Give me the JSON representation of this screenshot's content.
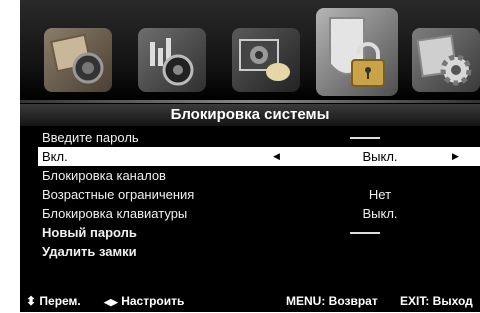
{
  "menu_title": "Блокировка системы",
  "tabs": [
    {
      "icon": "picture-icon",
      "active": false
    },
    {
      "icon": "sound-icon",
      "active": false
    },
    {
      "icon": "channel-icon",
      "active": false
    },
    {
      "icon": "lock-icon",
      "active": true
    },
    {
      "icon": "settings-gear-icon",
      "active": false
    }
  ],
  "items": [
    {
      "label": "Введите пароль",
      "value": "",
      "style": "normal"
    },
    {
      "label": "Вкл.",
      "value": "Выкл.",
      "style": "selected"
    },
    {
      "label": "Блокировка каналов",
      "value": "",
      "style": "normal"
    },
    {
      "label": "Возрастные ограничения",
      "value": "Нет",
      "style": "normal"
    },
    {
      "label": "Блокировка клавиатуры",
      "value": "Выкл.",
      "style": "normal"
    },
    {
      "label": "Новый пароль",
      "value": "",
      "style": "bold"
    },
    {
      "label": "Удалить замки",
      "value": "",
      "style": "bold"
    }
  ],
  "footer": {
    "move_label": "Перем.",
    "adjust_label": "Настроить",
    "menu_label": "MENU: Возврат",
    "exit_label": "EXIT: Выход"
  },
  "colors": {
    "background": "#000000",
    "selection": "#ffffff",
    "text": "#f0f0f0"
  }
}
